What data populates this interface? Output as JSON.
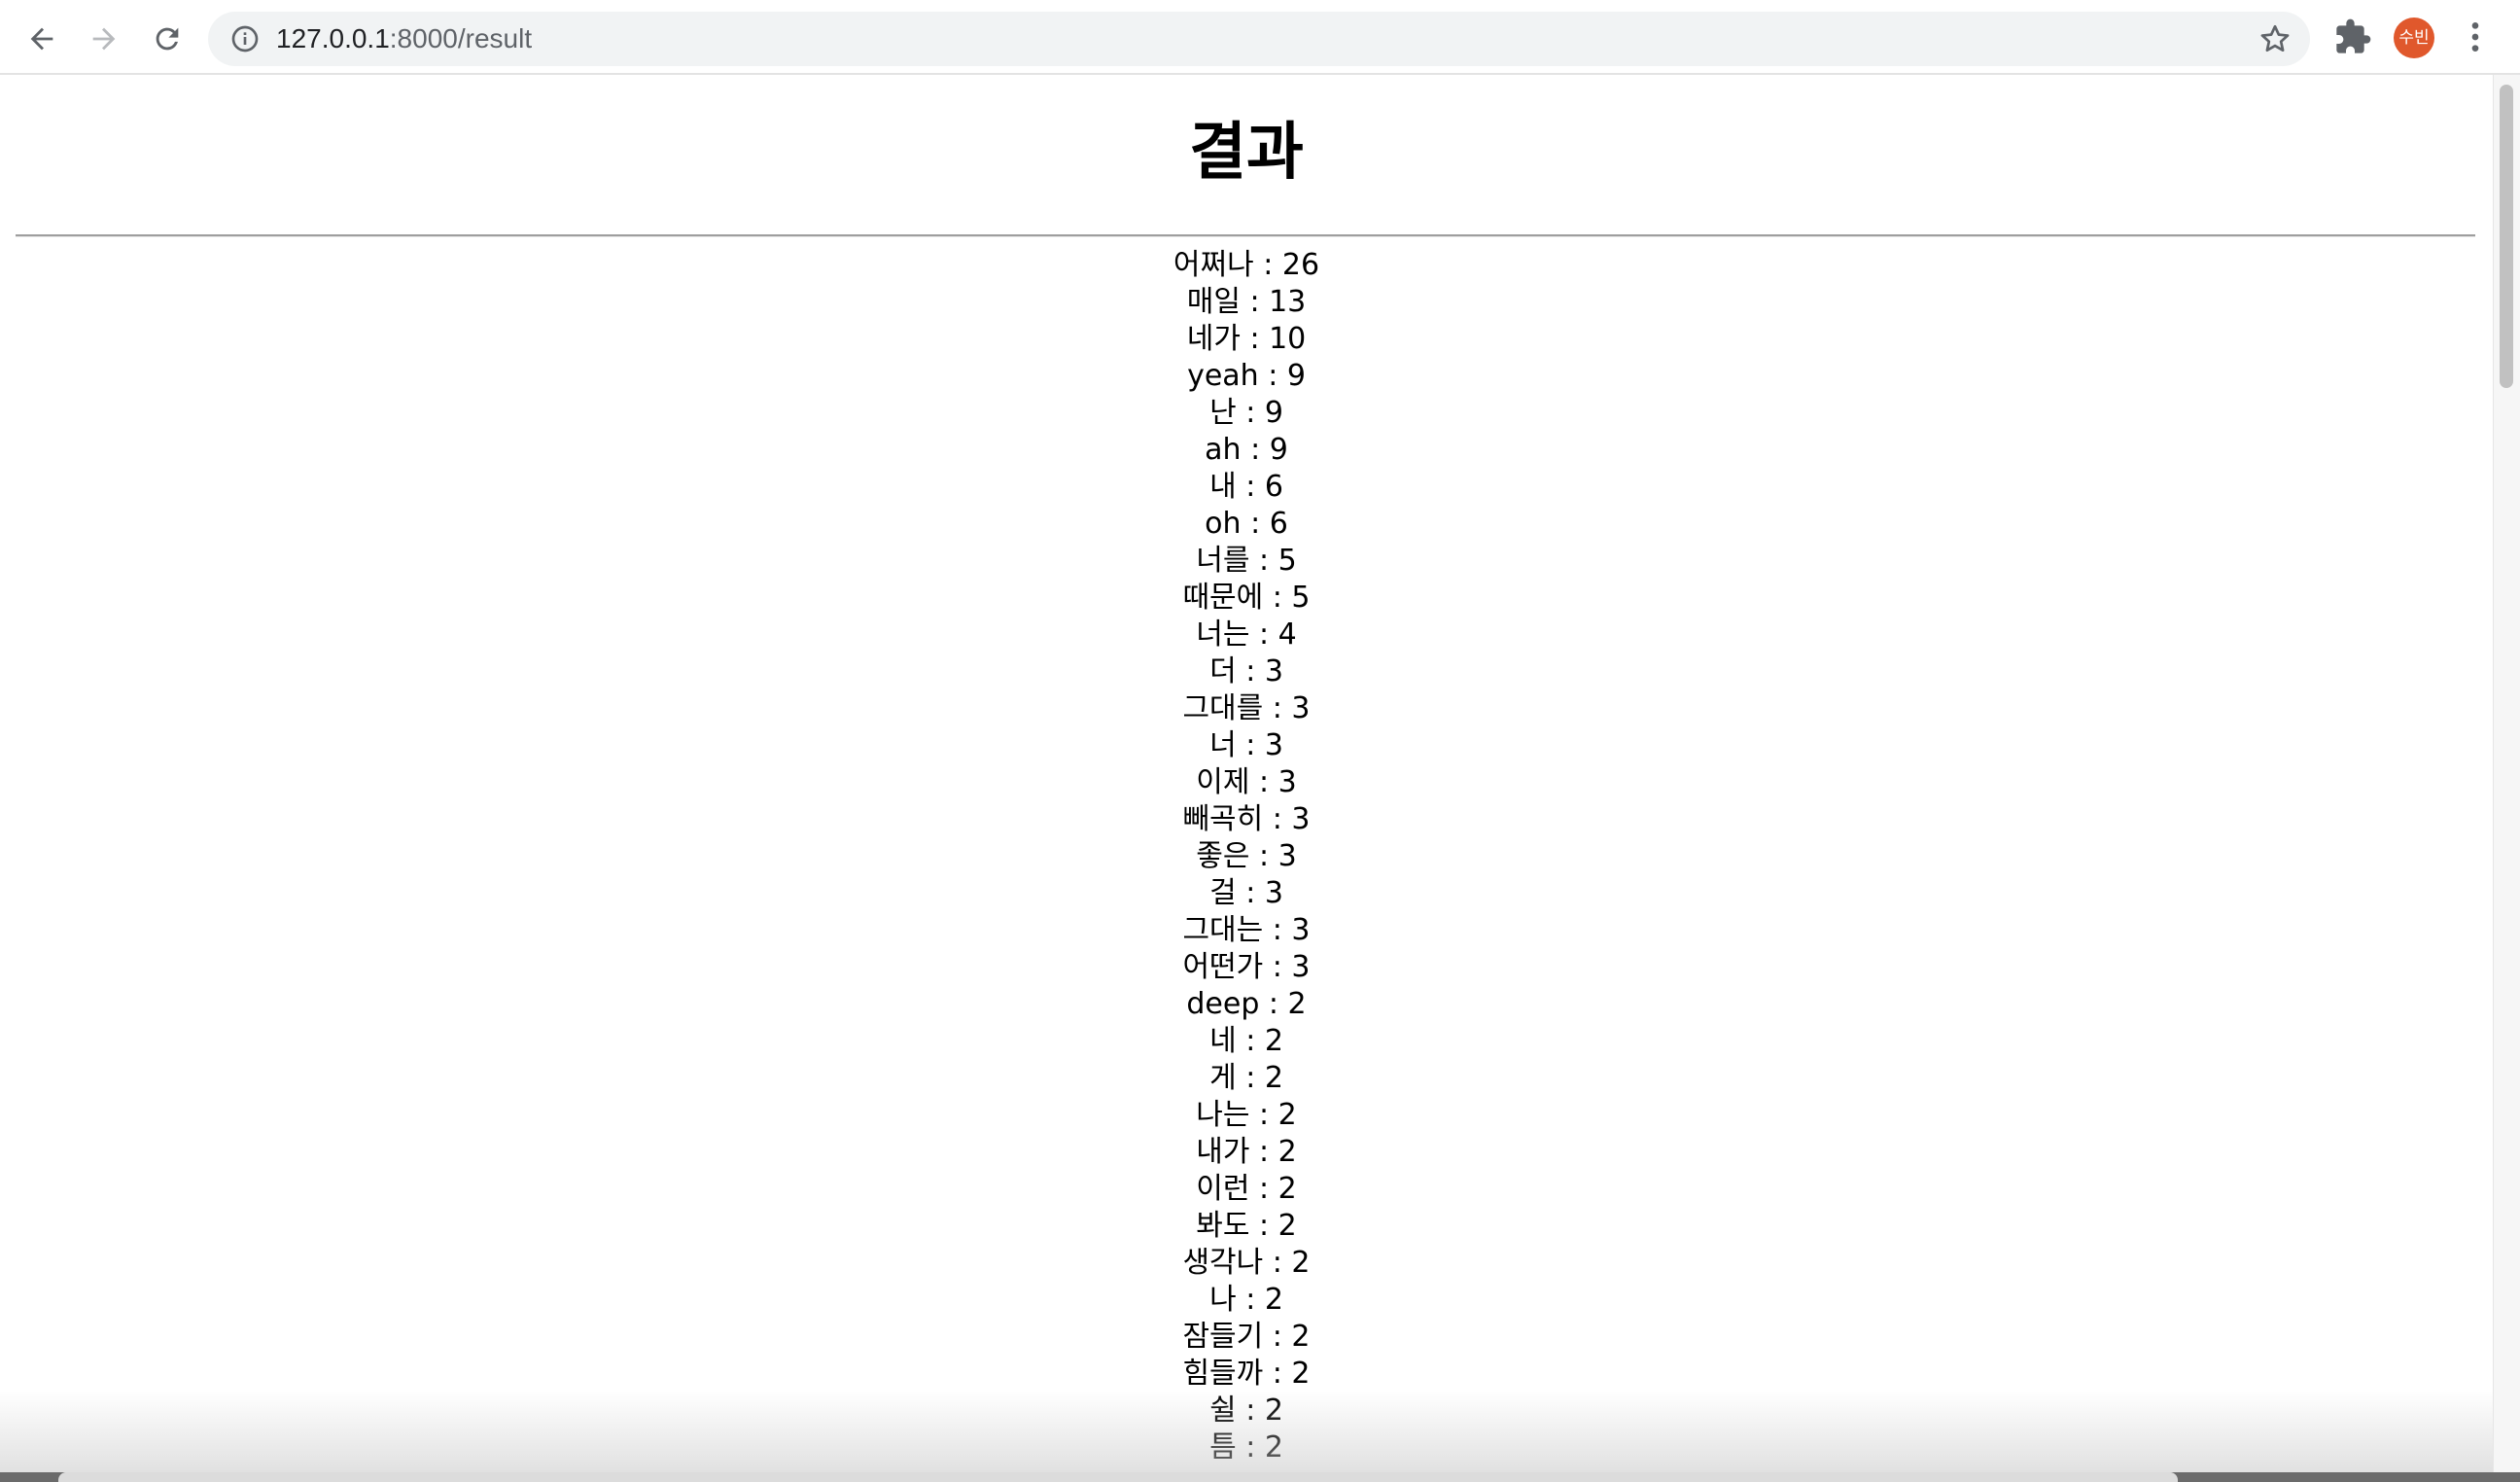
{
  "browser": {
    "url_host": "127.0.0.1",
    "url_path": ":8000/result",
    "profile_initials": "수빈",
    "icons": {
      "back": "back-arrow-icon",
      "forward": "forward-arrow-icon",
      "reload": "reload-icon",
      "site_info": "info-icon",
      "bookmark": "star-icon",
      "extensions": "puzzle-icon",
      "menu": "kebab-menu-icon"
    },
    "colors": {
      "avatar": "#e0582c",
      "omnibox_bg": "#f1f3f4"
    }
  },
  "page": {
    "title": "결과",
    "results": [
      {
        "text": "어쩌나 : 26"
      },
      {
        "text": "매일 : 13"
      },
      {
        "text": "네가 : 10"
      },
      {
        "text": "yeah : 9"
      },
      {
        "text": "난 : 9"
      },
      {
        "text": "ah : 9"
      },
      {
        "text": "내 : 6"
      },
      {
        "text": "oh : 6"
      },
      {
        "text": "너를 : 5"
      },
      {
        "text": "때문에 : 5"
      },
      {
        "text": "너는 : 4"
      },
      {
        "text": "더 : 3"
      },
      {
        "text": "그대를 : 3"
      },
      {
        "text": "너 : 3"
      },
      {
        "text": "이제 : 3"
      },
      {
        "text": "빼곡히 : 3"
      },
      {
        "text": "좋은 : 3"
      },
      {
        "text": "걸 : 3"
      },
      {
        "text": "그대는 : 3"
      },
      {
        "text": "어떤가 : 3"
      },
      {
        "text": "deep : 2"
      },
      {
        "text": "네 : 2"
      },
      {
        "text": "게 : 2"
      },
      {
        "text": "나는 : 2"
      },
      {
        "text": "내가 : 2"
      },
      {
        "text": "이런 : 2"
      },
      {
        "text": "봐도 : 2"
      },
      {
        "text": "생각나 : 2"
      },
      {
        "text": "나 : 2"
      },
      {
        "text": "잠들기 : 2"
      },
      {
        "text": "힘들까 : 2"
      },
      {
        "text": "쉴 : 2"
      },
      {
        "text": "틈 : 2"
      }
    ]
  }
}
